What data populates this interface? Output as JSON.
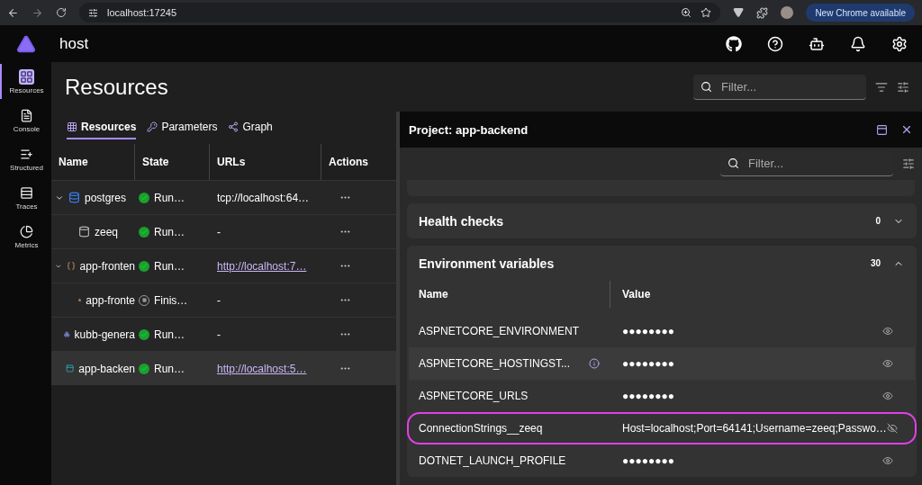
{
  "browser": {
    "url": "localhost:17245",
    "update_button": "New Chrome available"
  },
  "app": {
    "title": "host"
  },
  "sidebar": {
    "items": [
      {
        "label": "Resources",
        "kind": "resources",
        "selected": true
      },
      {
        "label": "Console",
        "kind": "console",
        "selected": false
      },
      {
        "label": "Structured",
        "kind": "structured",
        "selected": false
      },
      {
        "label": "Traces",
        "kind": "traces",
        "selected": false
      },
      {
        "label": "Metrics",
        "kind": "metrics",
        "selected": false
      }
    ]
  },
  "page": {
    "title": "Resources",
    "filter": {
      "placeholder": "Filter..."
    }
  },
  "tabs": [
    {
      "label": "Resources",
      "kind": "grid",
      "selected": true
    },
    {
      "label": "Parameters",
      "kind": "key",
      "selected": false
    },
    {
      "label": "Graph",
      "kind": "graph",
      "selected": false
    }
  ],
  "table": {
    "columns": [
      "Name",
      "State",
      "URLs",
      "Actions"
    ],
    "rows": [
      {
        "name": "postgres",
        "kind": "database",
        "state": "Run…",
        "finished": false,
        "url": "tcp://localhost:64…",
        "link": false,
        "selected": false,
        "expanded": true,
        "children": [
          {
            "name": "zeeq",
            "kind": "db",
            "state": "Run…",
            "finished": false,
            "url": "-",
            "link": false,
            "selected": false
          }
        ]
      },
      {
        "name": "app-fronten",
        "kind": "js",
        "state": "Run…",
        "finished": false,
        "url": "http://localhost:7…",
        "link": true,
        "selected": false,
        "expanded": true,
        "children": [
          {
            "name": "app-fronte",
            "kind": "task",
            "state": "Finis…",
            "finished": true,
            "url": "-",
            "link": false,
            "selected": false
          }
        ]
      },
      {
        "name": "kubb-genera",
        "kind": "exe",
        "state": "Run…",
        "finished": false,
        "url": "-",
        "link": false,
        "selected": false
      },
      {
        "name": "app-backen",
        "kind": "project",
        "state": "Run…",
        "finished": false,
        "url": "http://localhost:5…",
        "link": true,
        "selected": true
      }
    ]
  },
  "details": {
    "title": "Project: app-backend",
    "filter": {
      "placeholder": "Filter..."
    },
    "sections": [
      {
        "title": "Health checks",
        "count": "0",
        "expanded": false
      },
      {
        "title": "Environment variables",
        "count": "30",
        "expanded": true,
        "columns": [
          "Name",
          "Value"
        ],
        "rows": [
          {
            "name": "ASPNETCORE_ENVIRONMENT",
            "value": "●●●●●●●●",
            "revealed": false,
            "hovered": false,
            "highlighted": false
          },
          {
            "name": "ASPNETCORE_HOSTINGST...",
            "value": "●●●●●●●●",
            "revealed": false,
            "hovered": true,
            "highlighted": false
          },
          {
            "name": "ASPNETCORE_URLS",
            "value": "●●●●●●●●",
            "revealed": false,
            "hovered": false,
            "highlighted": false
          },
          {
            "name": "ConnectionStrings__zeeq",
            "value": "Host=localhost;Port=64141;Username=zeeq;Passwo…",
            "revealed": true,
            "hovered": false,
            "highlighted": true
          },
          {
            "name": "DOTNET_LAUNCH_PROFILE",
            "value": "●●●●●●●●",
            "revealed": false,
            "hovered": false,
            "highlighted": false
          }
        ]
      }
    ]
  }
}
